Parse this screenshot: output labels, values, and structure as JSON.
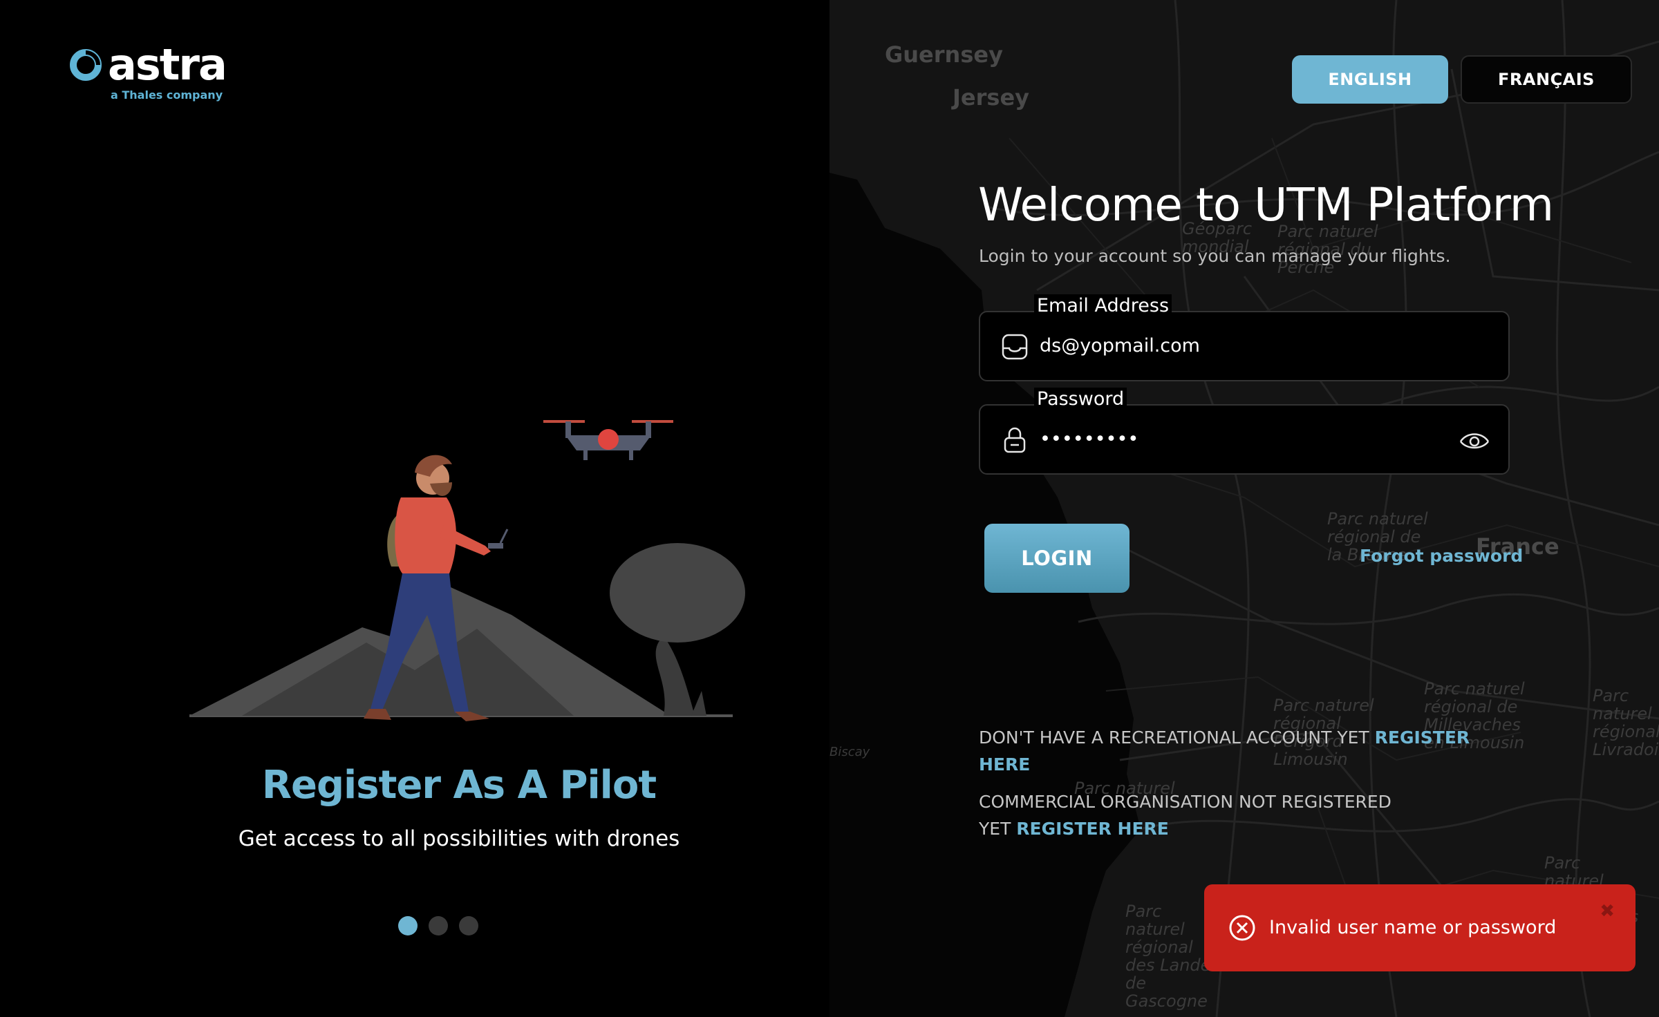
{
  "brand": {
    "name": "astra",
    "tagline": "a Thales company"
  },
  "map": {
    "labels": [
      {
        "id": "guernsey",
        "text": "Guernsey"
      },
      {
        "id": "jersey",
        "text": "Jersey"
      },
      {
        "id": "france",
        "text": "France"
      },
      {
        "id": "geoparc",
        "text": "Géoparc mondial"
      },
      {
        "id": "parc-perche",
        "text": "Parc naturel régional du Perche"
      },
      {
        "id": "parc-brenne",
        "text": "Parc naturel régional de la Brenne"
      },
      {
        "id": "parc-limousin",
        "text": "Parc naturel régional Périgord Limousin"
      },
      {
        "id": "parc-millevaches",
        "text": "Parc naturel régional de Millevaches en Limousin"
      },
      {
        "id": "parc-landes",
        "text": "Parc naturel régional des Landes de Gascogne"
      },
      {
        "id": "parc-livradois",
        "text": "Parc naturel régional Livradois"
      },
      {
        "id": "parc-grands-causses",
        "text": "Parc naturel régional des Grands Causses"
      },
      {
        "id": "parc-medoc",
        "text": "Parc naturel"
      },
      {
        "id": "biscay",
        "text": "Biscay"
      }
    ]
  },
  "carousel": {
    "title": "Register As A Pilot",
    "subtitle": "Get access to all possibilities with drones",
    "dots": [
      {
        "active": true
      },
      {
        "active": false
      },
      {
        "active": false
      }
    ]
  },
  "language": {
    "english": "ENGLISH",
    "french": "FRANÇAIS",
    "selected": "english"
  },
  "form": {
    "title": "Welcome to UTM Platform",
    "subtitle": "Login to your account so you can manage your flights.",
    "email": {
      "label": "Email Address",
      "value": "ds@yopmail.com",
      "icon": "inbox-icon"
    },
    "password": {
      "label": "Password",
      "value": "•••••••••",
      "icon": "lock-icon",
      "toggle_icon": "eye-icon"
    },
    "login_label": "LOGIN",
    "forgot_label": "Forgot password"
  },
  "registration": {
    "recreational_text": "DON'T HAVE A RECREATIONAL ACCOUNT YET",
    "recreational_link": "REGISTER HERE",
    "commercial_text": "COMMERCIAL ORGANISATION NOT REGISTERED YET",
    "commercial_link": "REGISTER HERE"
  },
  "toast": {
    "message": "Invalid user name or password",
    "icon": "error-circle-icon",
    "close_icon": "close-icon"
  },
  "colors": {
    "accent": "#6fb6d3",
    "error": "#c9221b",
    "background": "#000000"
  }
}
